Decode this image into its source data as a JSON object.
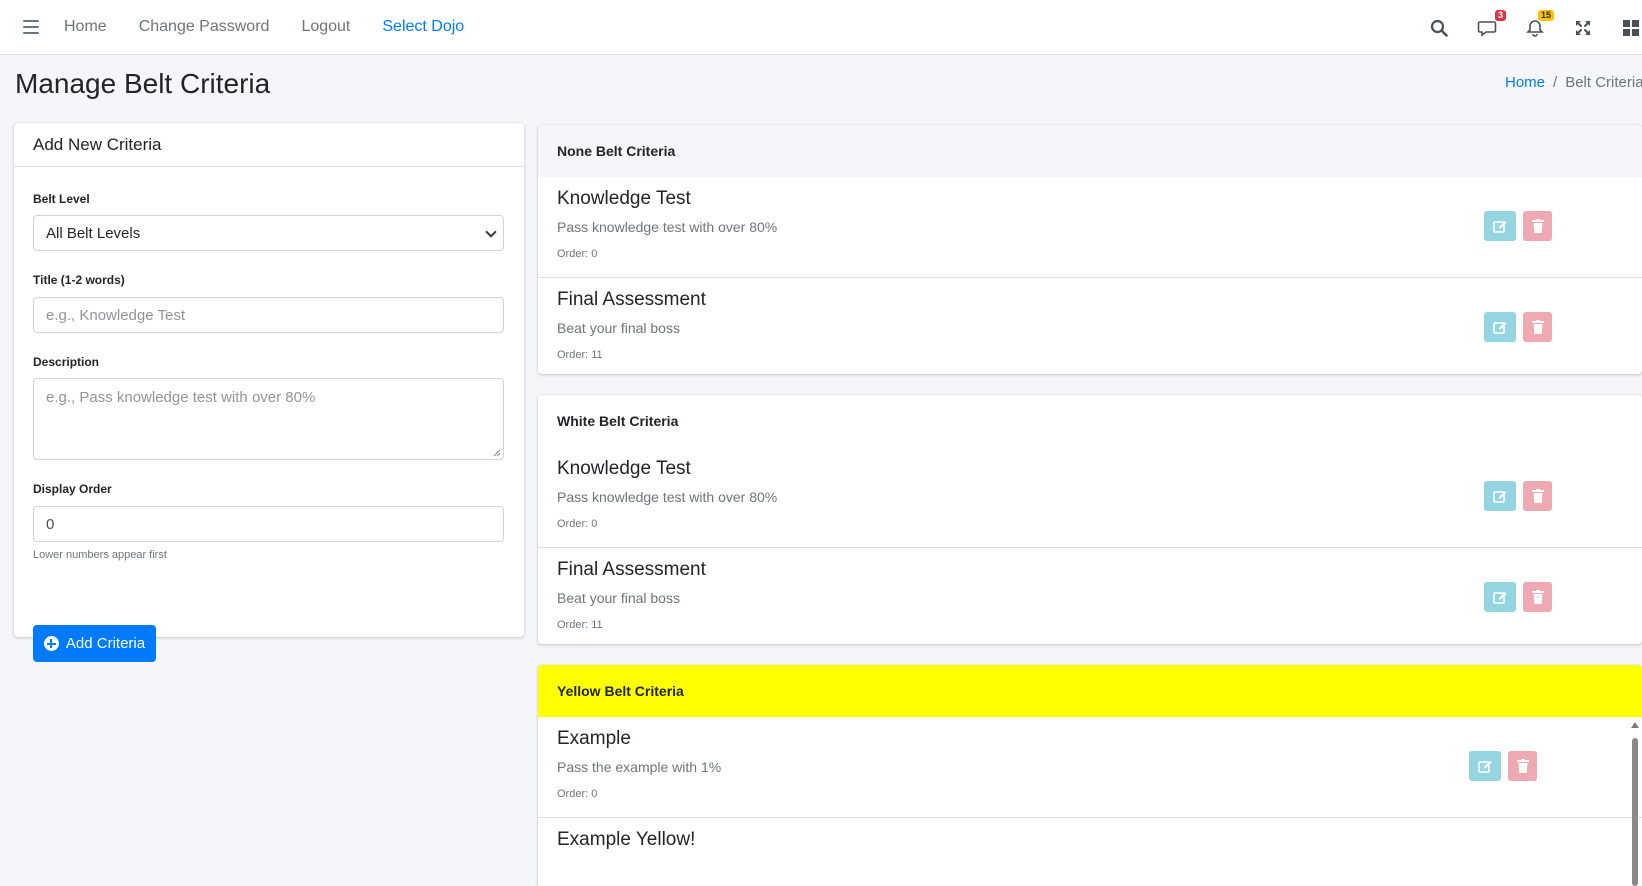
{
  "nav": {
    "links": [
      "Home",
      "Change Password",
      "Logout",
      "Select Dojo"
    ],
    "messages_badge": "3",
    "notifications_badge": "15",
    "accent_color": "#007bff"
  },
  "page": {
    "title": "Manage Belt Criteria",
    "breadcrumb_home": "Home",
    "breadcrumb_separator": "/",
    "breadcrumb_current": "Belt Criteria"
  },
  "form": {
    "header": "Add New Criteria",
    "belt_level_label": "Belt Level",
    "belt_level_value": "All Belt Levels",
    "title_label": "Title (1-2 words)",
    "title_placeholder": "e.g., Knowledge Test",
    "description_label": "Description",
    "description_placeholder": "e.g., Pass knowledge test with over 80%",
    "order_label": "Display Order",
    "order_value": "0",
    "order_help": "Lower numbers appear first",
    "submit_label": "Add Criteria"
  },
  "belts": [
    {
      "header": "None Belt Criteria",
      "header_bg": "#f4f6f9",
      "criteria": [
        {
          "title": "Knowledge Test",
          "description": "Pass knowledge test with over 80%",
          "order": "Order: 0"
        },
        {
          "title": "Final Assessment",
          "description": "Beat your final boss",
          "order": "Order: 11"
        }
      ]
    },
    {
      "header": "White Belt Criteria",
      "header_bg": "#ffffff",
      "criteria": [
        {
          "title": "Knowledge Test",
          "description": "Pass knowledge test with over 80%",
          "order": "Order: 0"
        },
        {
          "title": "Final Assessment",
          "description": "Beat your final boss",
          "order": "Order: 11"
        }
      ]
    },
    {
      "header": "Yellow Belt Criteria",
      "header_bg": "#ffff00",
      "criteria": [
        {
          "title": "Example",
          "description": "Pass the example with 1%",
          "order": "Order: 0"
        },
        {
          "title": "Example Yellow!",
          "description": "",
          "order": ""
        }
      ]
    }
  ],
  "colors": {
    "edit_button": "#95d5e1",
    "delete_button": "#efa9b0"
  }
}
